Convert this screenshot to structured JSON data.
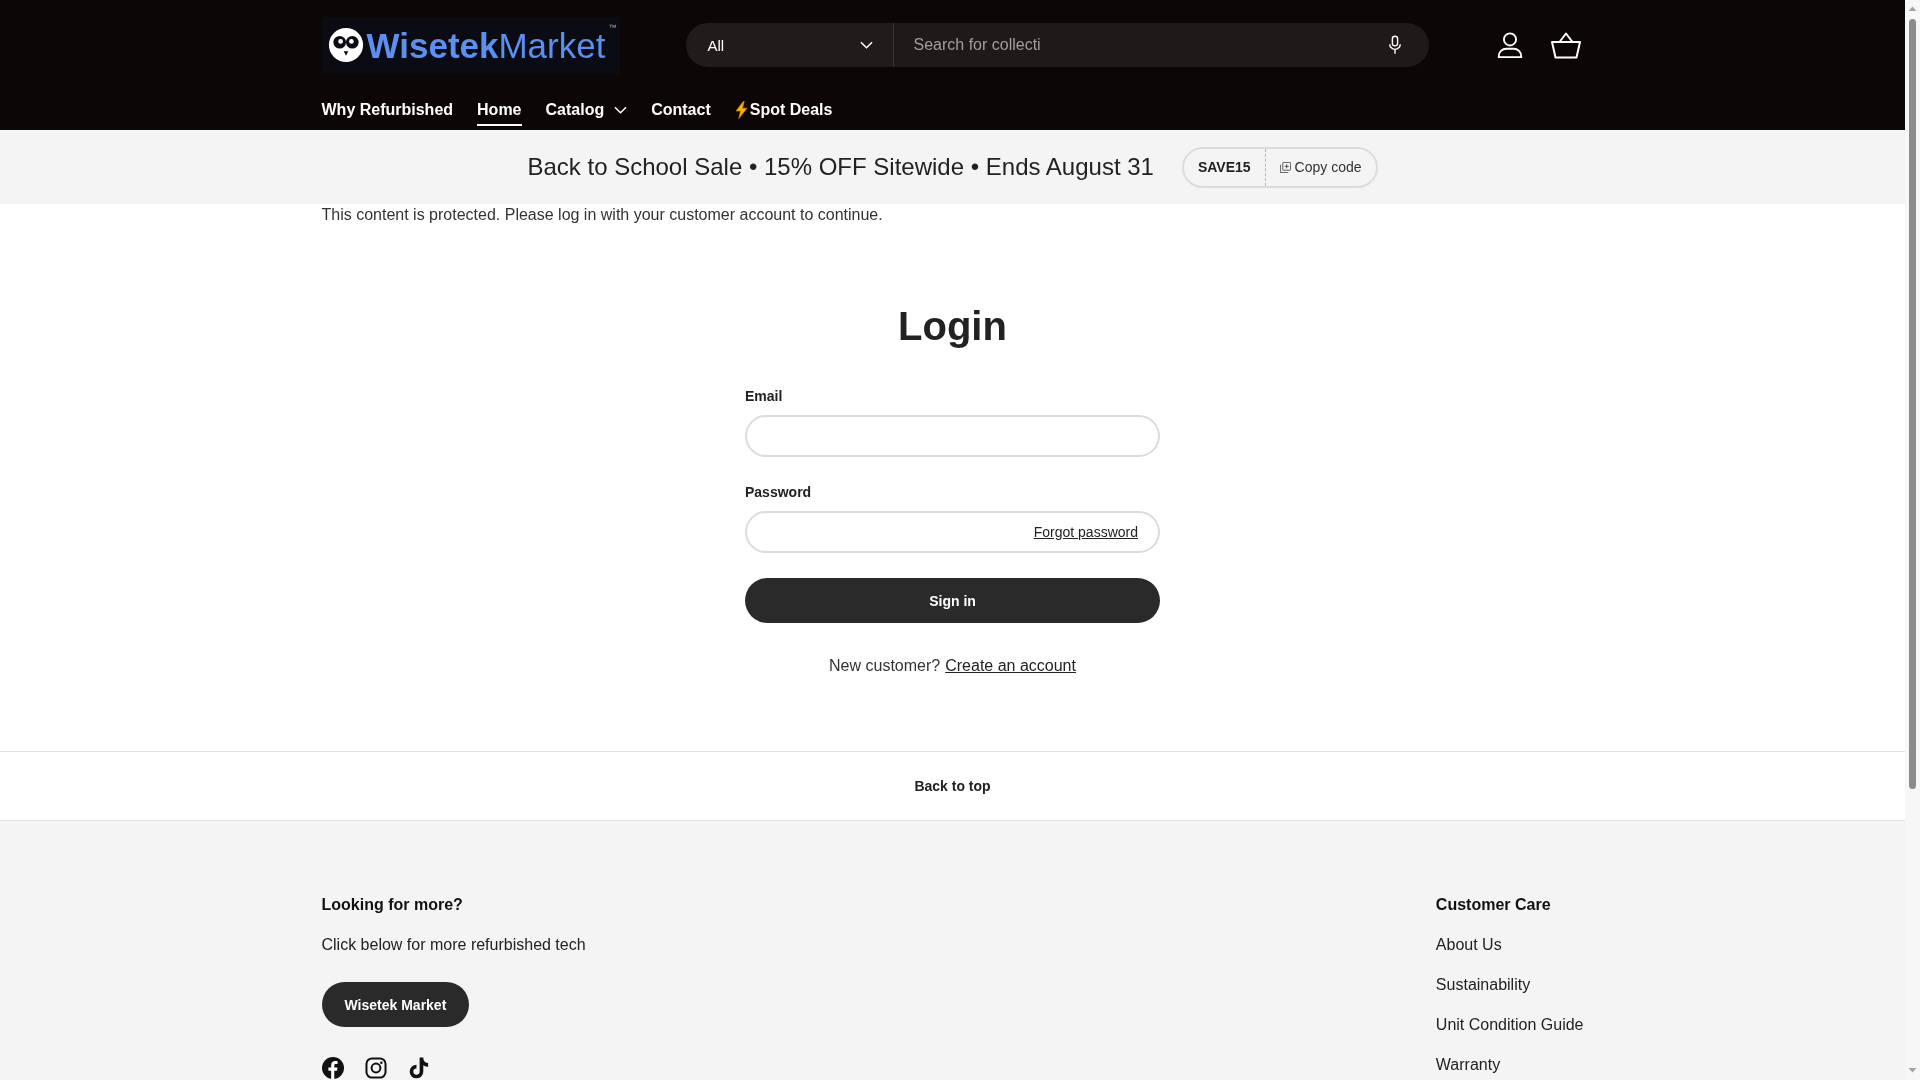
{
  "header": {
    "logo": {
      "text": "**Wisetek**Market",
      "trademark": "™"
    },
    "search": {
      "category": "All",
      "placeholder": "Search for collecti"
    },
    "nav": [
      {
        "label": "Why Refurbished",
        "kind": "link",
        "selected": false
      },
      {
        "label": "Home",
        "kind": "link",
        "selected": true
      },
      {
        "label": "Catalog",
        "kind": "dropdown",
        "selected": false
      },
      {
        "label": "Contact",
        "kind": "link",
        "selected": false
      },
      {
        "label": "Spot Deals",
        "kind": "promo",
        "selected": false
      }
    ]
  },
  "banner": {
    "text": "Back to School Sale • 15% OFF Sitewide • Ends August 31",
    "code": "SAVE15",
    "copy_button": "Copy code"
  },
  "notice": "This content is protected. Please log in with your customer account to continue.",
  "login": {
    "title": "Login",
    "fields": [
      {
        "label": "Email"
      },
      {
        "label": "Password",
        "link": "Forgot password"
      }
    ],
    "submit": "Sign in",
    "signup": {
      "text": "New customer?",
      "link": "Create an account"
    }
  },
  "back_to_top": "Back to top",
  "footer": {
    "promo": {
      "heading": "Looking for more?",
      "text": "Click below for more refurbished tech",
      "button": "Wisetek Market"
    },
    "customer_care": {
      "heading": "Customer Care",
      "links": [
        "About Us",
        "Sustainability",
        "Unit Condition Guide",
        "Warranty"
      ]
    }
  }
}
